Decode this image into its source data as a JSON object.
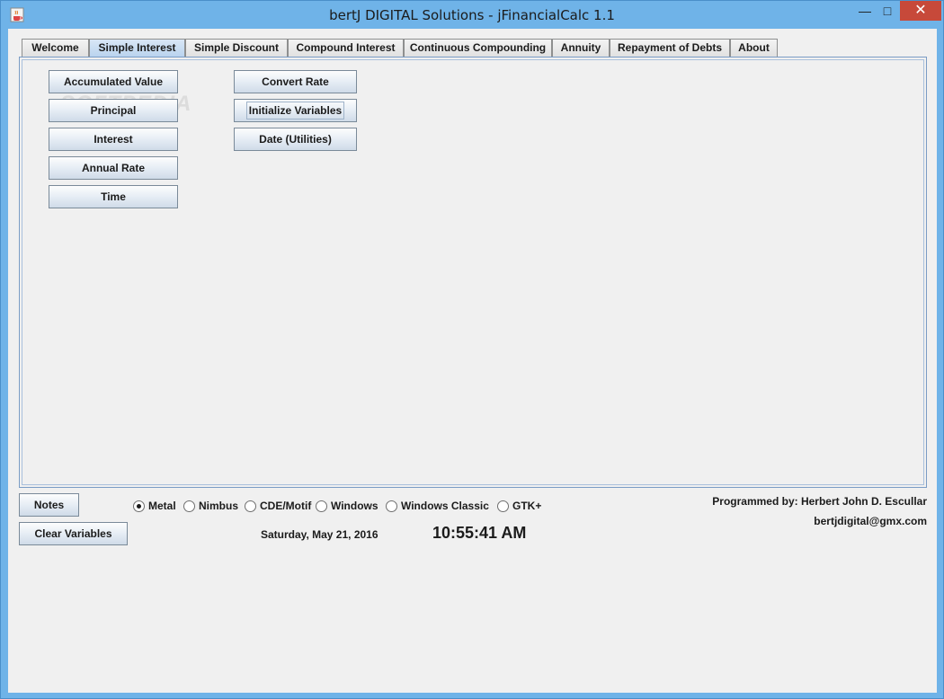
{
  "window": {
    "title": "bertJ DIGITAL Solutions - jFinancialCalc 1.1",
    "minimize_label": "—",
    "maximize_label": "□",
    "close_label": "✕",
    "app_icon": "java-coffee-icon"
  },
  "tabs": [
    {
      "label": "Welcome"
    },
    {
      "label": "Simple Interest"
    },
    {
      "label": "Simple Discount"
    },
    {
      "label": "Compound Interest"
    },
    {
      "label": "Continuous Compounding"
    },
    {
      "label": "Annuity"
    },
    {
      "label": "Repayment of Debts"
    },
    {
      "label": "About"
    }
  ],
  "active_tab": "Simple Interest",
  "simple_interest": {
    "left_buttons": [
      {
        "label": "Accumulated Value"
      },
      {
        "label": "Principal"
      },
      {
        "label": "Interest"
      },
      {
        "label": "Annual Rate"
      },
      {
        "label": "Time"
      }
    ],
    "right_buttons": [
      {
        "label": "Convert Rate"
      },
      {
        "label": "Initialize Variables"
      },
      {
        "label": "Date (Utilities)"
      }
    ]
  },
  "bottom": {
    "notes_label": "Notes",
    "clear_label": "Clear Variables",
    "look_and_feel": {
      "options": [
        "Metal",
        "Nimbus",
        "CDE/Motif",
        "Windows",
        "Windows Classic",
        "GTK+"
      ],
      "selected": "Metal"
    },
    "date": "Saturday, May 21, 2016",
    "time": "10:55:41 AM",
    "credit": "Programmed by: Herbert John D. Escullar",
    "email": "bertjdigital@gmx.com"
  },
  "watermark": "SOFTPEDIA",
  "colors": {
    "title_bar": "#6fb3e8",
    "close_button": "#c7493a",
    "client_bg": "#f0f0f0"
  }
}
